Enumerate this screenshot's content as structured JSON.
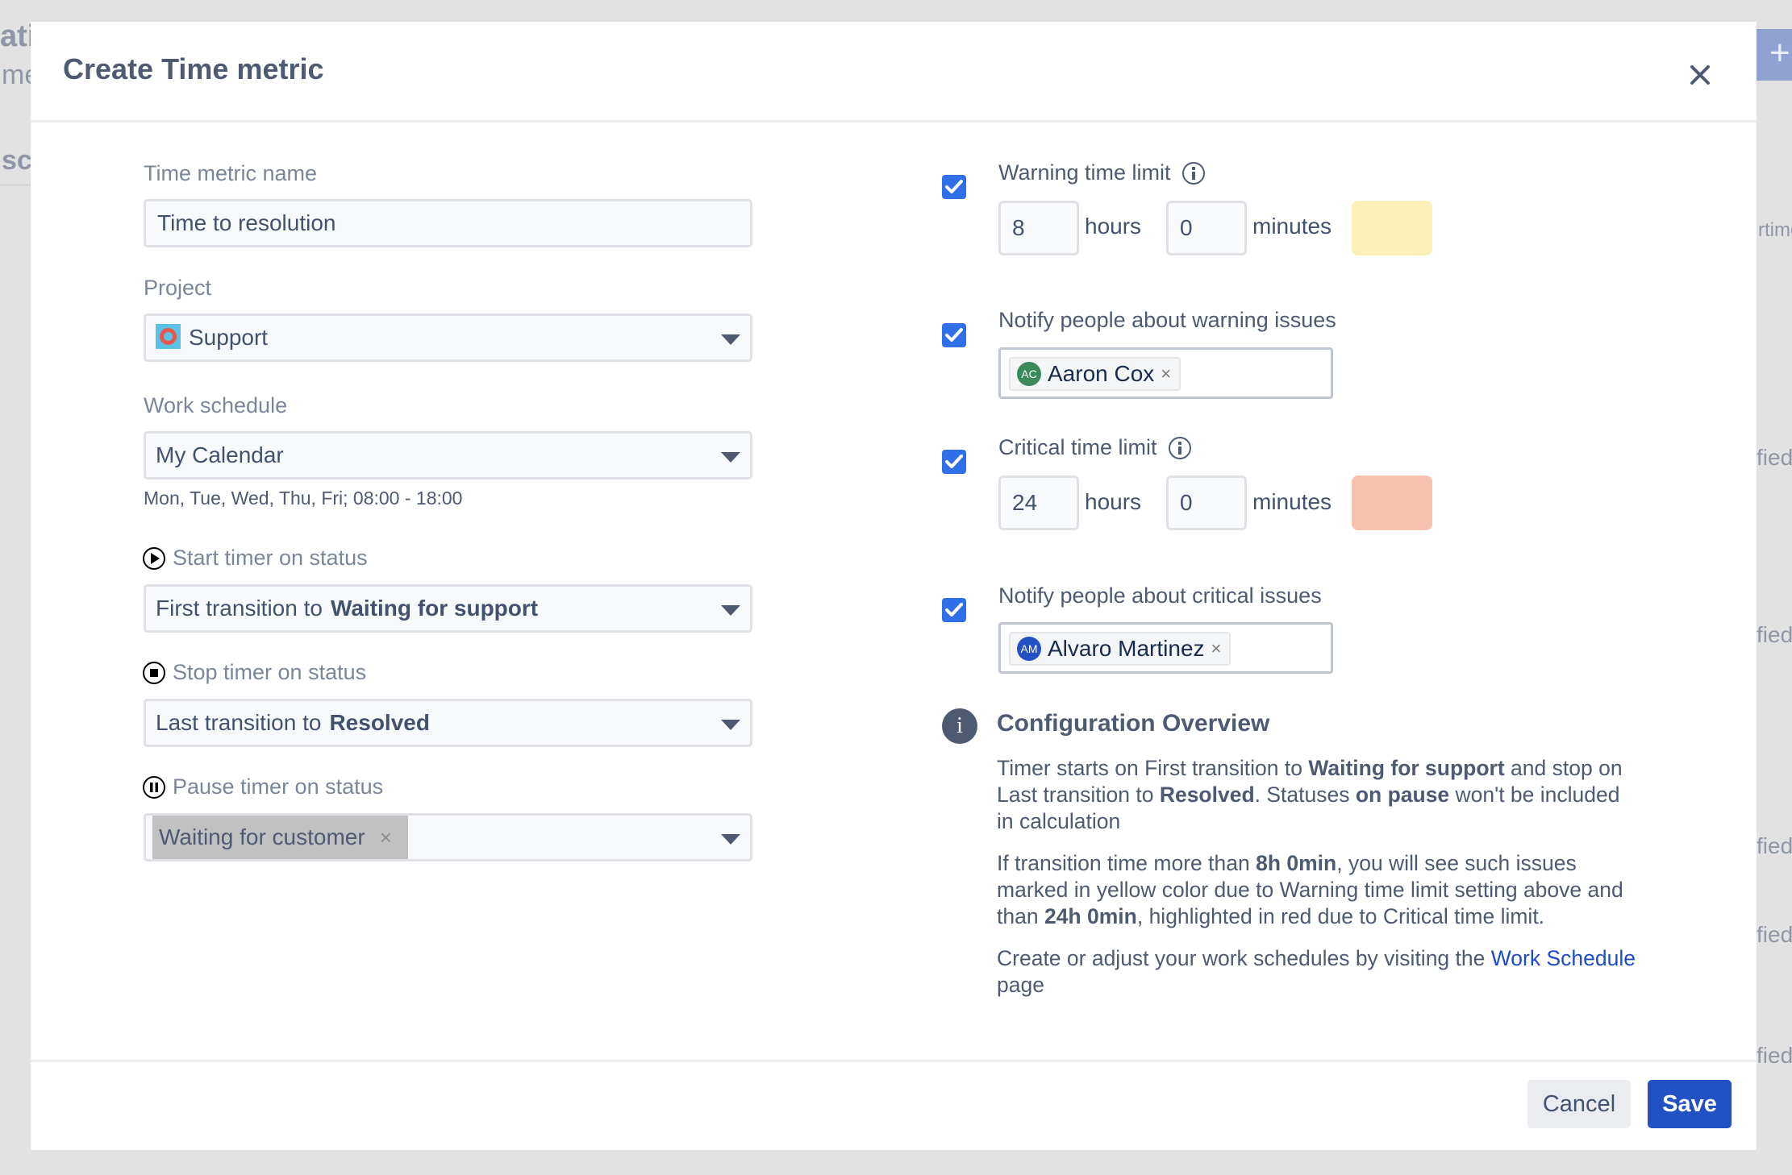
{
  "background": {
    "fragments": [
      "atic",
      "me",
      "scl",
      "rtime",
      "fied",
      "fied",
      "fied",
      "fied",
      "fied"
    ],
    "add_button_label": "+"
  },
  "modal": {
    "title": "Create Time metric",
    "close_icon": "close-icon"
  },
  "form": {
    "name": {
      "label": "Time metric name",
      "value": "Time to resolution"
    },
    "project": {
      "label": "Project",
      "value": "Support",
      "icon": "lifebuoy-icon"
    },
    "work_schedule": {
      "label": "Work schedule",
      "value": "My Calendar",
      "hint": "Mon, Tue, Wed, Thu, Fri; 08:00 - 18:00"
    },
    "start_timer": {
      "label": "Start timer on status",
      "icon": "play-circle-icon",
      "prefix": "First transition to",
      "status": "Waiting for support"
    },
    "stop_timer": {
      "label": "Stop timer on status",
      "icon": "stop-circle-icon",
      "prefix": "Last transition to",
      "status": "Resolved"
    },
    "pause_timer": {
      "label": "Pause timer on status",
      "icon": "pause-circle-icon",
      "tags": [
        "Waiting for customer"
      ],
      "tag_remove": "×"
    }
  },
  "limits": {
    "warning": {
      "checked": true,
      "label": "Warning time limit",
      "hours": "8",
      "hours_unit": "hours",
      "minutes": "0",
      "minutes_unit": "minutes",
      "color": "#fcf0b8"
    },
    "notify_warning": {
      "checked": true,
      "label": "Notify people about warning issues",
      "users": [
        {
          "initials": "AC",
          "name": "Aaron Cox",
          "avatar_color": "#3b8a5a"
        }
      ]
    },
    "critical": {
      "checked": true,
      "label": "Critical time limit",
      "hours": "24",
      "hours_unit": "hours",
      "minutes": "0",
      "minutes_unit": "minutes",
      "color": "#f5c1ae"
    },
    "notify_critical": {
      "checked": true,
      "label": "Notify people about critical issues",
      "users": [
        {
          "initials": "AM",
          "name": "Alvaro Martinez",
          "avatar_color": "#2351c4"
        }
      ]
    },
    "remove_symbol": "×"
  },
  "overview": {
    "title": "Configuration Overview",
    "p1": {
      "t1": "Timer starts on First transition to ",
      "b1": "Waiting for support",
      "t2": " and stop on Last transition to ",
      "b2": "Resolved",
      "t3": ". Statuses ",
      "b3": "on pause",
      "t4": " won't be included in calculation"
    },
    "p2": {
      "t1": "If transition time more than ",
      "b1": "8h 0min",
      "t2": ", you will see such issues marked in yellow color due to Warning time limit setting above and than ",
      "b2": "24h 0min",
      "t3": ", highlighted in red due to Critical time limit."
    },
    "p3": {
      "t1": "Create or adjust your work schedules by visiting the ",
      "link": "Work Schedule",
      "t2": " page"
    }
  },
  "footer": {
    "cancel_label": "Cancel",
    "save_label": "Save"
  }
}
